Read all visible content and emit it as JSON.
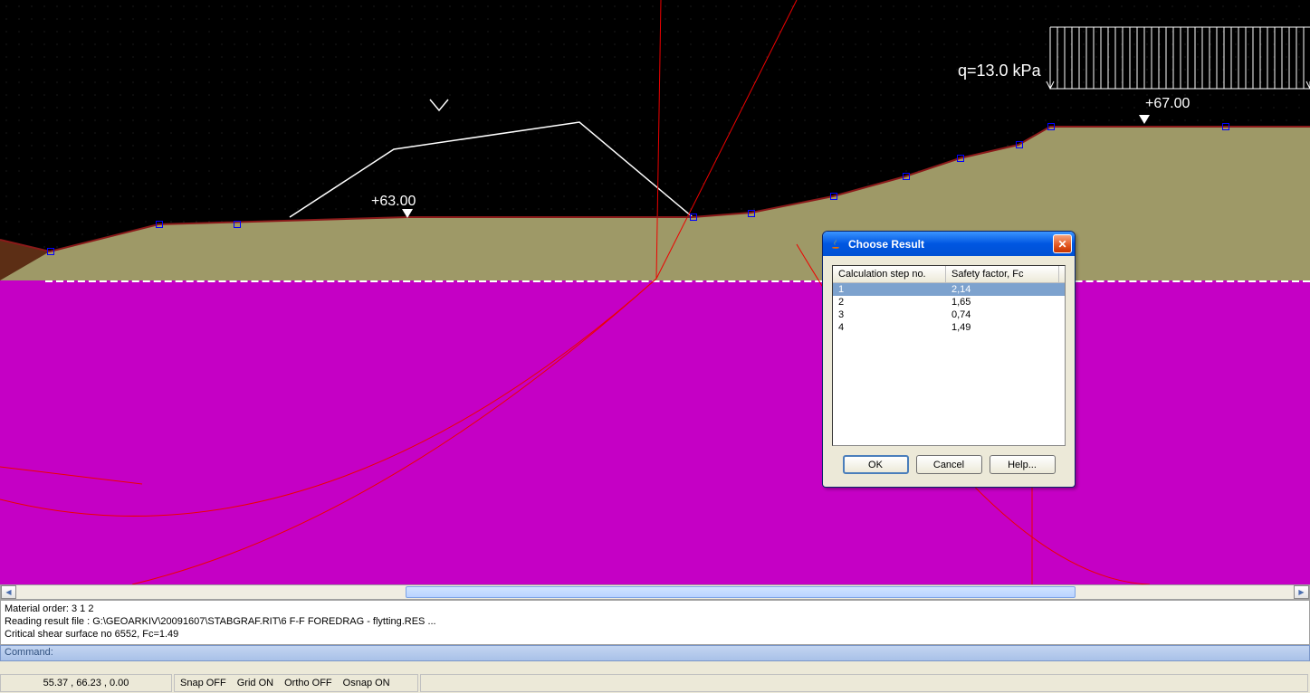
{
  "canvas": {
    "load_label": "q=13.0  kPa",
    "elev_right": "+67.00",
    "elev_left": "+63.00"
  },
  "dialog": {
    "title": "Choose Result",
    "columns": {
      "step": "Calculation step no.",
      "fc": "Safety factor, Fc"
    },
    "rows": [
      {
        "step": "1",
        "fc": "2,14"
      },
      {
        "step": "2",
        "fc": "1,65"
      },
      {
        "step": "3",
        "fc": "0,74"
      },
      {
        "step": "4",
        "fc": "1,49"
      }
    ],
    "buttons": {
      "ok": "OK",
      "cancel": "Cancel",
      "help": "Help..."
    }
  },
  "log": {
    "line1": "Material order: 3 1 2",
    "line2": "Reading result file : G:\\GEOARKIV\\20091607\\STABGRAF.RIT\\6 F-F FOREDRAG - flytting.RES ...",
    "line3": "Critical shear surface no 6552, Fc=1.49"
  },
  "command": {
    "label": "Command:"
  },
  "status": {
    "coords": "55.37 , 66.23 , 0.00",
    "snap": "Snap OFF",
    "grid": "Grid ON",
    "ortho": "Ortho OFF",
    "osnap": "Osnap ON"
  }
}
